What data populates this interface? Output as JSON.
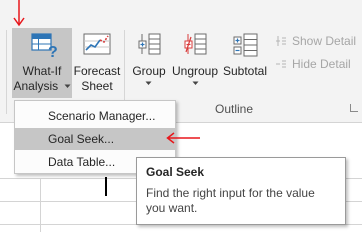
{
  "ribbon": {
    "what_if": {
      "line1": "What-If",
      "line2": "Analysis",
      "dropdown_icon": "chevron-down-icon"
    },
    "forecast": {
      "line1": "Forecast",
      "line2": "Sheet"
    },
    "group": {
      "label": "Group"
    },
    "ungroup": {
      "label": "Ungroup"
    },
    "subtotal": {
      "label": "Subtotal"
    },
    "show_detail": {
      "label": "Show Detail"
    },
    "hide_detail": {
      "label": "Hide Detail"
    },
    "outline_group_label": "Outline"
  },
  "menu": {
    "items": [
      {
        "label": "Scenario Manager...",
        "highlighted": false
      },
      {
        "label": "Goal Seek...",
        "highlighted": true
      },
      {
        "label": "Data Table...",
        "highlighted": false
      }
    ]
  },
  "tooltip": {
    "title": "Goal Seek",
    "body_line1": "Find the right input for the value",
    "body_line2": "you want."
  },
  "colors": {
    "ribbon_bg": "#f3f3f3",
    "highlight": "#c6c6c6",
    "annotation_red": "#e8161b",
    "icon_blue": "#2e75b6",
    "icon_red": "#d83b3b"
  }
}
